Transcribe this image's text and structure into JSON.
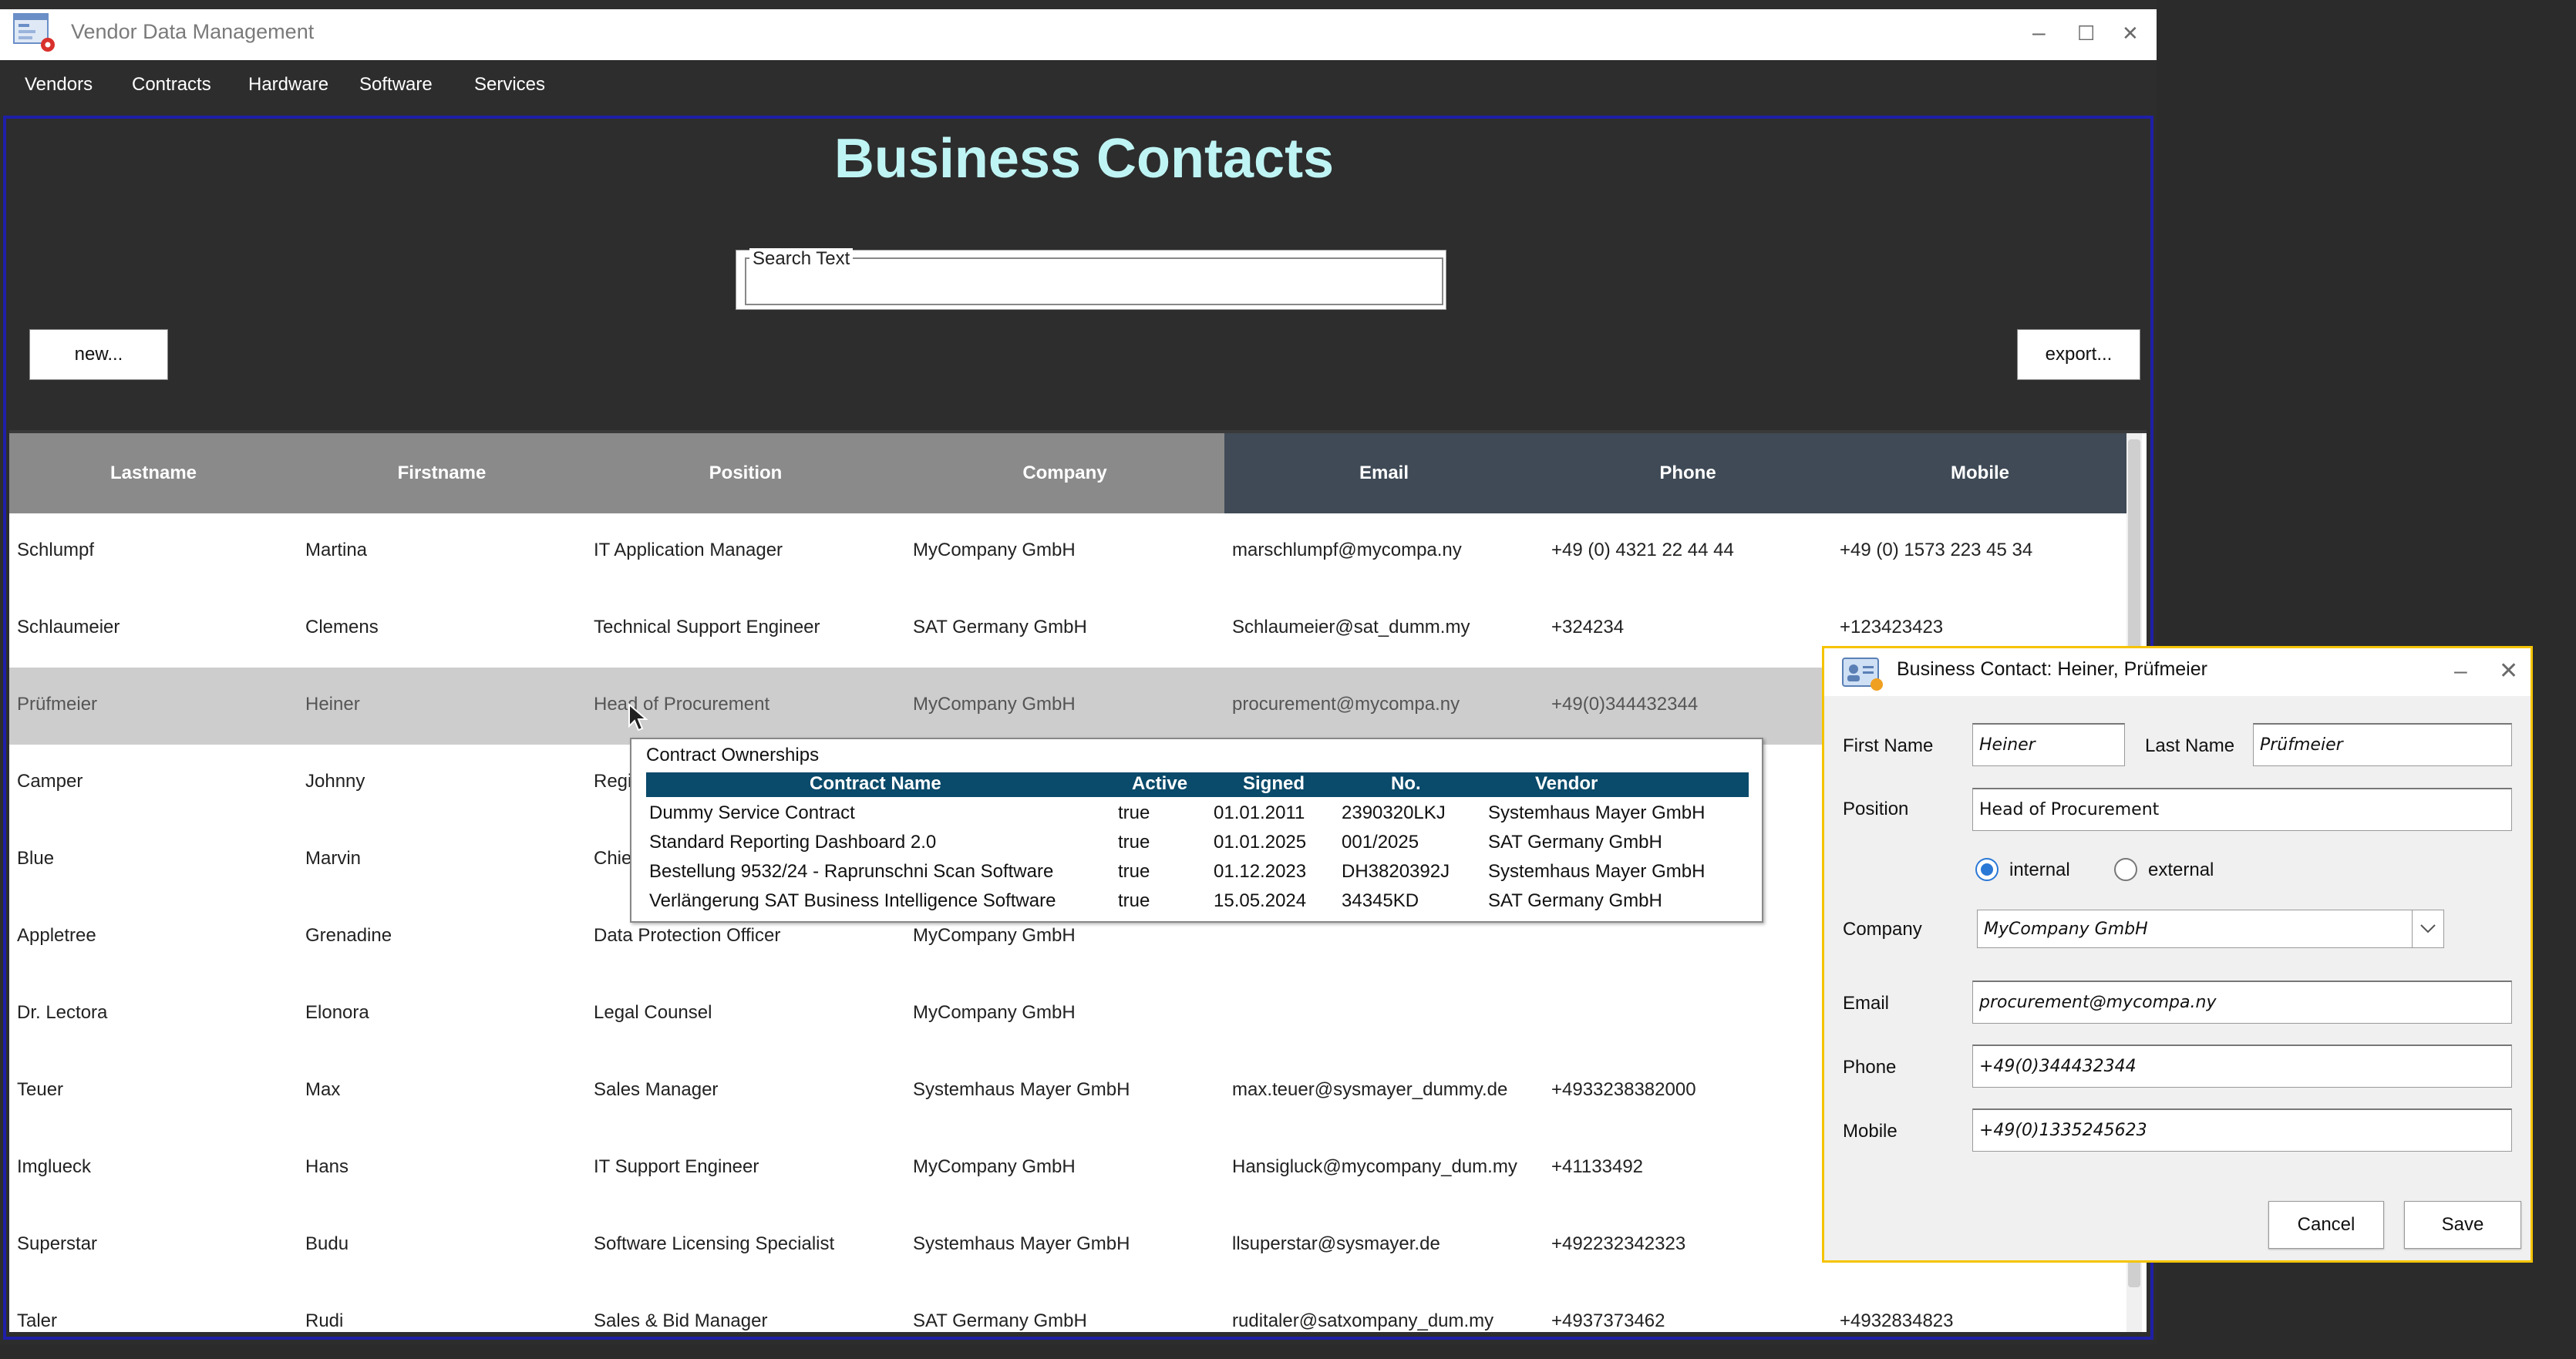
{
  "window": {
    "title": "Vendor Data Management",
    "controls": {
      "minimize": "–",
      "maximize": "☐",
      "close": "✕"
    }
  },
  "menu": [
    "Vendors",
    "Contracts",
    "Hardware",
    "Software",
    "Services"
  ],
  "main": {
    "heading": "Business Contacts",
    "search_legend": "Search Text",
    "search_value": "",
    "new_button": "new...",
    "export_button": "export..."
  },
  "table": {
    "columns": [
      "Lastname",
      "Firstname",
      "Position",
      "Company",
      "Email",
      "Phone",
      "Mobile"
    ],
    "rows": [
      [
        "Schlumpf",
        "Martina",
        "IT Application Manager",
        "MyCompany GmbH",
        "marschlumpf@mycompa.ny",
        "+49 (0) 4321 22 44 44",
        "+49 (0) 1573 223 45 34"
      ],
      [
        "Schlaumeier",
        "Clemens",
        "Technical Support Engineer",
        "SAT Germany GmbH",
        "Schlaumeier@sat_dumm.my",
        "+324234",
        "+123423423"
      ],
      [
        "Prüfmeier",
        "Heiner",
        "Head of Procurement",
        "MyCompany GmbH",
        "procurement@mycompa.ny",
        "+49(0)344432344",
        ""
      ],
      [
        "Camper",
        "Johnny",
        "Regi",
        "",
        "",
        "",
        ""
      ],
      [
        "Blue",
        "Marvin",
        "Chie",
        "",
        "",
        "",
        ""
      ],
      [
        "Appletree",
        "Grenadine",
        "Data Protection Officer",
        "MyCompany GmbH",
        "",
        "",
        ""
      ],
      [
        "Dr. Lectora",
        "Elonora",
        "Legal Counsel",
        "MyCompany GmbH",
        "",
        "",
        ""
      ],
      [
        "Teuer",
        "Max",
        "Sales Manager",
        "Systemhaus Mayer GmbH",
        "max.teuer@sysmayer_dummy.de",
        "+4933238382000",
        ""
      ],
      [
        "Imglueck",
        "Hans",
        "IT Support Engineer",
        "MyCompany GmbH",
        "Hansigluck@mycompany_dum.my",
        "+41133492",
        ""
      ],
      [
        "Superstar",
        "Budu",
        "Software Licensing Specialist",
        "Systemhaus Mayer GmbH",
        "llsuperstar@sysmayer.de",
        "+492232342323",
        ""
      ],
      [
        "Taler",
        "Rudi",
        "Sales & Bid Manager",
        "SAT Germany GmbH",
        "ruditaler@satxompany_dum.my",
        "+4937373462",
        "+4932834823"
      ]
    ],
    "selected_row": 2
  },
  "tooltip": {
    "title": "Contract Ownerships",
    "columns": [
      "Contract Name",
      "Active",
      "Signed",
      "No.",
      "Vendor"
    ],
    "rows": [
      [
        "Dummy Service Contract",
        "true",
        "01.01.2011",
        "2390320LKJ",
        "Systemhaus Mayer GmbH"
      ],
      [
        "Standard Reporting Dashboard 2.0",
        "true",
        "01.01.2025",
        "001/2025",
        "SAT Germany GmbH"
      ],
      [
        "Bestellung 9532/24 - Raprunschni Scan Software",
        "true",
        "01.12.2023",
        "DH3820392J",
        "Systemhaus Mayer GmbH"
      ],
      [
        "Verlängerung SAT Business Intelligence Software",
        "true",
        "15.05.2024",
        "34345KD",
        "SAT Germany GmbH"
      ]
    ]
  },
  "dialog": {
    "title": "Business Contact: Heiner, Prüfmeier",
    "first_name_label": "First Name",
    "first_name": "Heiner",
    "last_name_label": "Last Name",
    "last_name": "Prüfmeier",
    "position_label": "Position",
    "position": "Head of Procurement",
    "radio_internal": "internal",
    "radio_external": "external",
    "type_selected": "internal",
    "company_label": "Company",
    "company": "MyCompany GmbH",
    "email_label": "Email",
    "email": "procurement@mycompa.ny",
    "phone_label": "Phone",
    "phone": "+49(0)344432344",
    "mobile_label": "Mobile",
    "mobile": "+49(0)1335245623",
    "cancel_button": "Cancel",
    "save_button": "Save"
  },
  "colors": {
    "heading": "#bff4f4",
    "header_gray": "#8a8a8a",
    "header_slate": "#3f4a56",
    "tooltip_header": "#0a4a6a",
    "dialog_border": "#f5c400",
    "content_border": "#1f1fa8"
  }
}
